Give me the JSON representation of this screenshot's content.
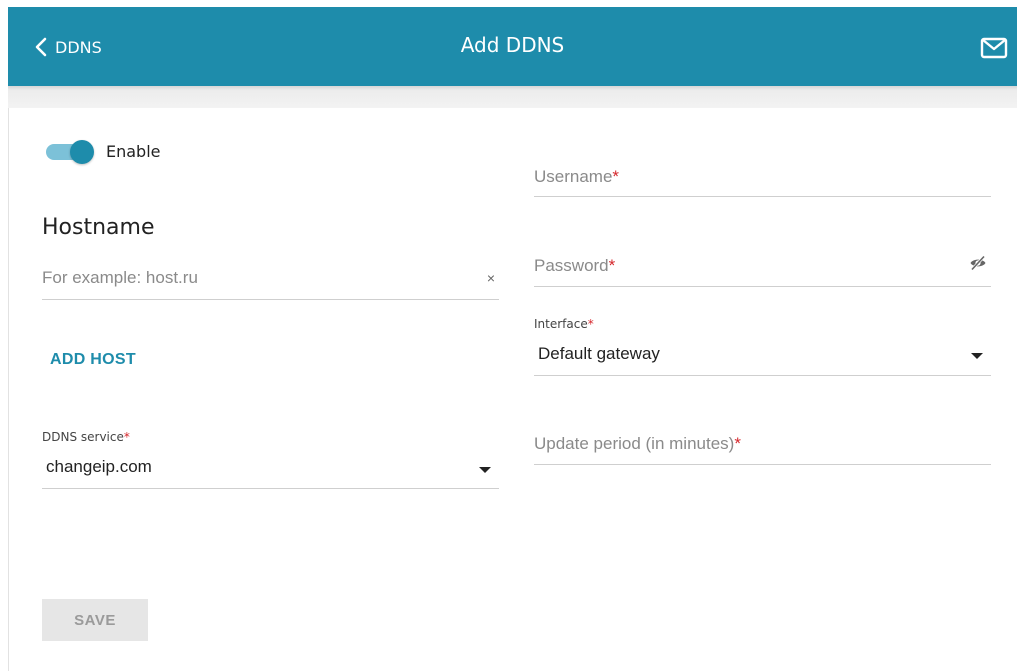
{
  "header": {
    "back_label": "DDNS",
    "title": "Add DDNS",
    "bg_color": "#1e8cab"
  },
  "enable": {
    "label": "Enable",
    "on": true
  },
  "hostname": {
    "title": "Hostname",
    "placeholder": "For example: host.ru",
    "clear_glyph": "×",
    "add_host_label": "ADD HOST"
  },
  "ddns_service": {
    "label": "DDNS service",
    "required_mark": "*",
    "value": "changeip.com"
  },
  "username": {
    "placeholder": "Username",
    "required_mark": "*"
  },
  "password": {
    "placeholder": "Password",
    "required_mark": "*"
  },
  "interface": {
    "label": "Interface",
    "required_mark": "*",
    "value": "Default gateway"
  },
  "update_period": {
    "placeholder": "Update period (in minutes)",
    "required_mark": "*"
  },
  "save_label": "SAVE",
  "icons": {
    "back": "chevron-left-icon",
    "mail": "mail-icon",
    "password_visibility": "eye-off-icon",
    "dropdown": "caret-down-icon"
  }
}
